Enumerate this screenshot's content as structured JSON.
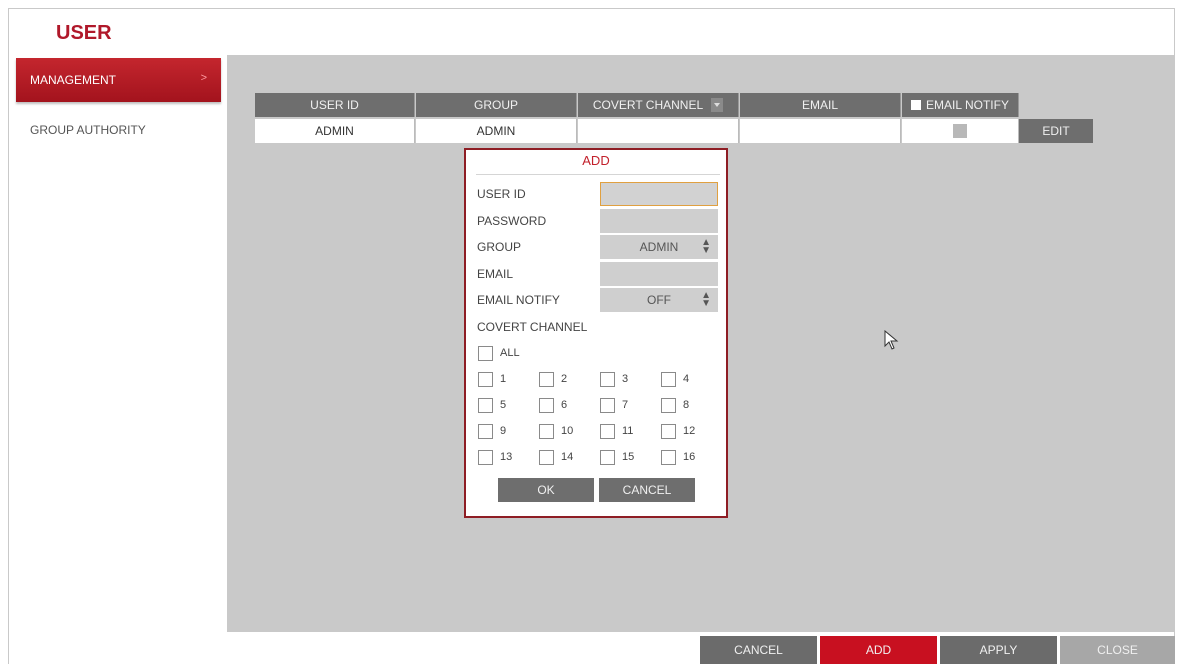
{
  "header": {
    "title": "USER"
  },
  "sidebar": {
    "items": [
      {
        "label": "MANAGEMENT",
        "chevron": ">"
      },
      {
        "label": "GROUP AUTHORITY"
      }
    ]
  },
  "table": {
    "headers": [
      "USER ID",
      "GROUP",
      "COVERT CHANNEL",
      "EMAIL",
      "EMAIL NOTIFY"
    ],
    "rows": [
      {
        "user_id": "ADMIN",
        "group": "ADMIN",
        "covert_channel": "",
        "email": ""
      }
    ],
    "edit_label": "EDIT"
  },
  "dialog": {
    "title": "ADD",
    "user_id_label": "USER ID",
    "user_id_value": "",
    "password_label": "PASSWORD",
    "password_value": "",
    "group_label": "GROUP",
    "group_value": "ADMIN",
    "email_label": "EMAIL",
    "email_value": "",
    "email_notify_label": "EMAIL NOTIFY",
    "email_notify_value": "OFF",
    "covert_channel_label": "COVERT CHANNEL",
    "all_label": "ALL",
    "channels": [
      "1",
      "2",
      "3",
      "4",
      "5",
      "6",
      "7",
      "8",
      "9",
      "10",
      "11",
      "12",
      "13",
      "14",
      "15",
      "16"
    ],
    "ok_label": "OK",
    "cancel_label": "CANCEL"
  },
  "footer": {
    "cancel_label": "CANCEL",
    "add_label": "ADD",
    "apply_label": "APPLY",
    "close_label": "CLOSE"
  },
  "colors": {
    "accent": "#b0182a",
    "active_sidebar": "#b51d26",
    "header_bg": "#6e6e6e",
    "panel_bg": "#c9c9c9",
    "add_button": "#c81020",
    "close_button": "#a7a7a7"
  }
}
